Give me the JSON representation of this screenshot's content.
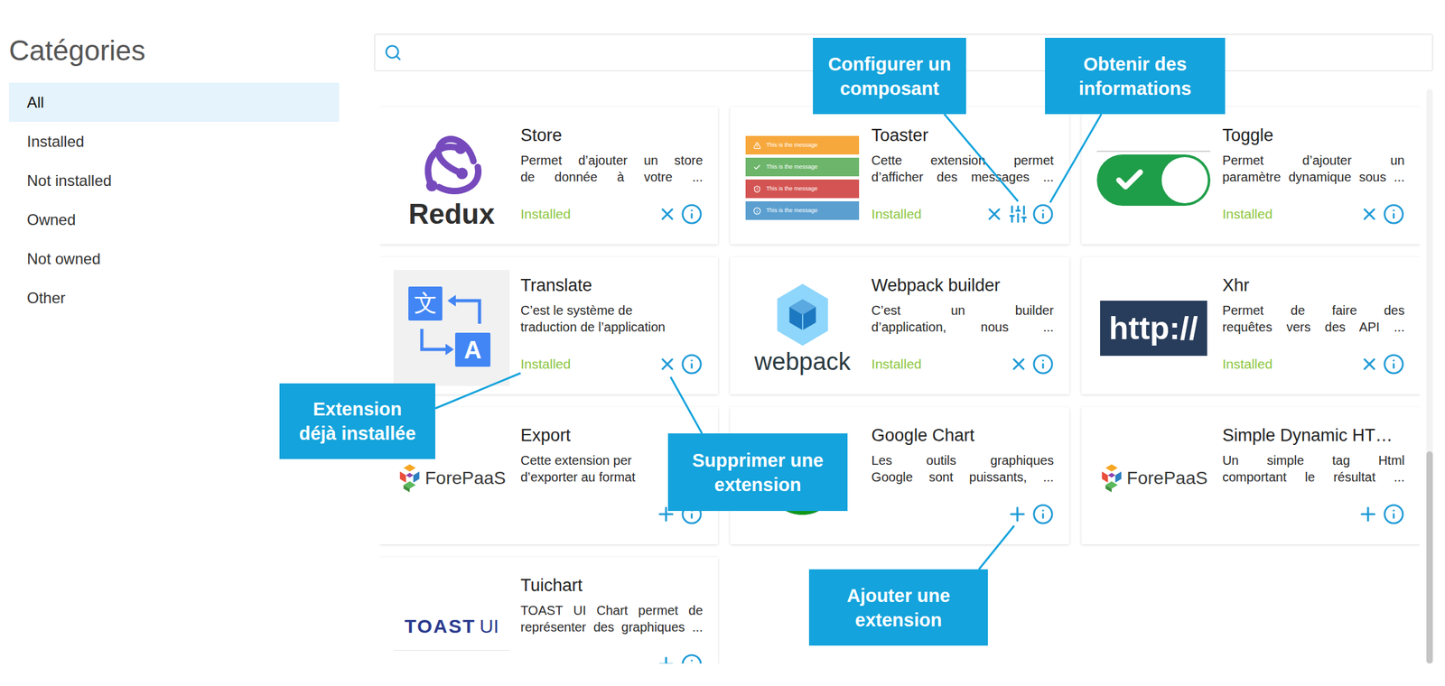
{
  "sidebar": {
    "title": "Catégories",
    "items": [
      {
        "label": "All",
        "selected": true
      },
      {
        "label": "Installed",
        "selected": false
      },
      {
        "label": "Not installed",
        "selected": false
      },
      {
        "label": "Owned",
        "selected": false
      },
      {
        "label": "Not owned",
        "selected": false
      },
      {
        "label": "Other",
        "selected": false
      }
    ]
  },
  "search": {
    "value": ""
  },
  "extensions": [
    {
      "name": "Store",
      "description": [
        "Permet d’ajouter un store",
        "de donnée à votre ..."
      ],
      "installed": true,
      "status": "Installed",
      "configurable": false,
      "logo": {
        "kind": "redux",
        "text": "Redux"
      }
    },
    {
      "name": "Toaster",
      "description": [
        "Cette extension permet",
        "d’afficher des messages ..."
      ],
      "installed": true,
      "status": "Installed",
      "configurable": true,
      "logo": {
        "kind": "toaster",
        "messages": [
          {
            "text": "This is the message",
            "kind": "warning",
            "color": "#f7a83c"
          },
          {
            "text": "This is the message",
            "kind": "success",
            "color": "#6db56b"
          },
          {
            "text": "This is the message",
            "kind": "error",
            "color": "#d35452"
          },
          {
            "text": "This is the message",
            "kind": "info",
            "color": "#5b9fd0"
          }
        ]
      }
    },
    {
      "name": "Toggle",
      "description": [
        "Permet d’ajouter un",
        "paramètre dynamique sous ..."
      ],
      "installed": true,
      "status": "Installed",
      "configurable": false,
      "logo": {
        "kind": "toggle",
        "on": true
      }
    },
    {
      "name": "Translate",
      "description": [
        "C’est le système de",
        "traduction de l’application"
      ],
      "installed": true,
      "status": "Installed",
      "configurable": false,
      "logo": {
        "kind": "translate",
        "source": "文",
        "target": "A"
      }
    },
    {
      "name": "Webpack builder",
      "description": [
        "C’est un builder",
        "d’application, nous ..."
      ],
      "installed": true,
      "status": "Installed",
      "configurable": false,
      "logo": {
        "kind": "webpack",
        "text": "webpack"
      }
    },
    {
      "name": "Xhr",
      "description": [
        "Permet de faire des",
        "requêtes vers des API ..."
      ],
      "installed": true,
      "status": "Installed",
      "configurable": false,
      "logo": {
        "kind": "http",
        "text": "http://"
      }
    },
    {
      "name": "Export",
      "description": [
        "Cette extension per",
        "d’exporter au format"
      ],
      "installed": false,
      "status": "",
      "configurable": false,
      "logo": {
        "kind": "forepaas",
        "text": "ForePaaS"
      }
    },
    {
      "name": "Google Chart",
      "description": [
        "Les outils graphiques",
        "Google sont puissants, ..."
      ],
      "installed": false,
      "status": "",
      "configurable": false,
      "logo": {
        "kind": "googlechart"
      }
    },
    {
      "name": "Simple Dynamic HT…",
      "description": [
        "Un simple tag Html",
        "comportant le résultat ..."
      ],
      "installed": false,
      "status": "",
      "configurable": false,
      "logo": {
        "kind": "forepaas",
        "text": "ForePaaS"
      }
    },
    {
      "name": "Tuichart",
      "description": [
        "TOAST UI Chart permet de",
        "représenter des graphiques ..."
      ],
      "installed": false,
      "status": "",
      "configurable": false,
      "logo": {
        "kind": "toastui",
        "text": "TOAST",
        "suffix": "UI"
      }
    }
  ],
  "callouts": [
    {
      "lines": [
        "Configurer un",
        "composant"
      ]
    },
    {
      "lines": [
        "Obtenir des",
        "informations"
      ]
    },
    {
      "lines": [
        "Extension",
        "déjà installée"
      ]
    },
    {
      "lines": [
        "Supprimer une",
        "extension"
      ]
    },
    {
      "lines": [
        "Ajouter une",
        "extension"
      ]
    }
  ]
}
